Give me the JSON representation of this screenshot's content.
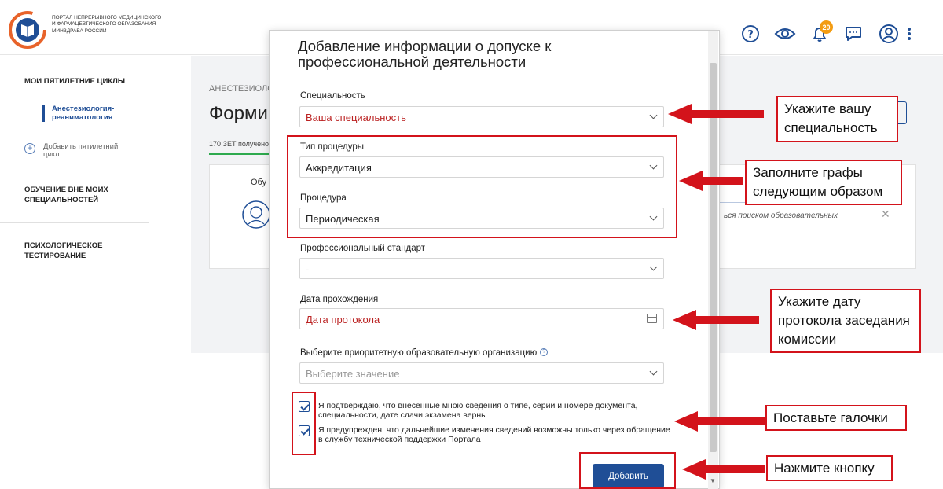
{
  "header": {
    "logo_text": "Портал непрерывного медицинского и фармацевтического образования Минздрава России",
    "notification_count": "20",
    "icons": [
      "help-icon",
      "eye-icon",
      "bell-icon",
      "chat-icon",
      "user-icon",
      "more-icon"
    ]
  },
  "sidebar": {
    "my_cycles": "МОИ ПЯТИЛЕТНИЕ ЦИКЛЫ",
    "active_cycle": "Анестезиология-реаниматология",
    "add_cycle": "Добавить пятилетний цикл",
    "outside_training": "ОБУЧЕНИЕ ВНЕ МОИХ СПЕЦИАЛЬНОСТЕЙ",
    "psych_testing": "ПСИХОЛОГИЧЕСКОЕ ТЕСТИРОВАНИЕ"
  },
  "background": {
    "breadcrumb": "АНЕСТЕЗИОЛО",
    "title": "Форми",
    "zet": "170 ЗЕТ получено",
    "card_text": "Обу",
    "hint_text": "ься поиском образовательных"
  },
  "modal": {
    "title": "Добавление информации о допуске к профессиональной деятельности",
    "specialty_label": "Специальность",
    "specialty_value": "Ваша специальность",
    "procedure_type_label": "Тип процедуры",
    "procedure_type_value": "Аккредитация",
    "procedure_label": "Процедура",
    "procedure_value": "Периодическая",
    "prof_standard_label": "Профессиональный стандарт",
    "prof_standard_value": "-",
    "date_label": "Дата прохождения",
    "date_value": "Дата протокола",
    "org_label": "Выберите приоритетную образовательную организацию",
    "org_placeholder": "Выберите значение",
    "check1": "Я подтверждаю, что внесенные мною сведения о типе, серии и номере документа, специальности, дате сдачи экзамена верны",
    "check2": "Я предупрежден, что дальнейшие изменения сведений возможны только через обращение в службу технической поддержки Портала",
    "submit": "Добавить"
  },
  "annotations": {
    "specialty": "Укажите вашу специальность",
    "procedure": "Заполните графы следующим образом",
    "date": "Укажите дату протокола заседания комиссии",
    "checkboxes": "Поставьте галочки",
    "button": "Нажмите кнопку"
  },
  "colors": {
    "accent": "#1f4e96",
    "annotation_red": "#d3131b",
    "progress_green": "#2eaa4e",
    "badge_orange": "#f39c12"
  }
}
